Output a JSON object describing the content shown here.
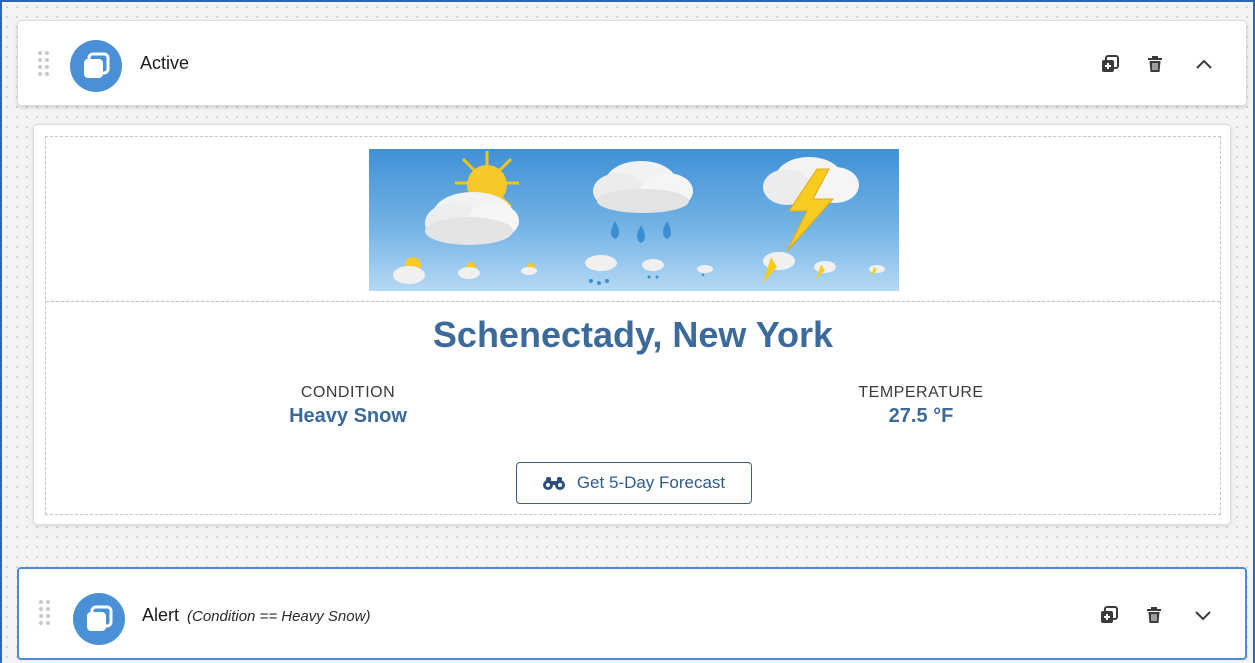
{
  "active_panel": {
    "title": "Active",
    "icons": [
      "drag-handle-icon",
      "copy-stack-icon",
      "duplicate-icon",
      "trash-icon",
      "chevron-up-icon"
    ]
  },
  "weather_card": {
    "banner_icons": [
      "sun-cloud-icon",
      "rain-cloud-icon",
      "thunder-cloud-icon"
    ],
    "location": "Schenectady, New York",
    "condition_label": "CONDITION",
    "condition_value": "Heavy Snow",
    "temperature_label": "TEMPERATURE",
    "temperature_value": "27.5 °F",
    "forecast_button": "Get 5-Day Forecast",
    "forecast_icon": "binoculars-icon"
  },
  "alert_panel": {
    "title": "Alert",
    "subtitle": "(Condition == Heavy Snow)",
    "icons": [
      "drag-handle-icon",
      "copy-stack-icon",
      "duplicate-icon",
      "trash-icon",
      "chevron-down-icon"
    ]
  },
  "colors": {
    "accent": "#4a90d6",
    "heading": "#3c6a9a",
    "selection_border": "#2f67b4"
  }
}
